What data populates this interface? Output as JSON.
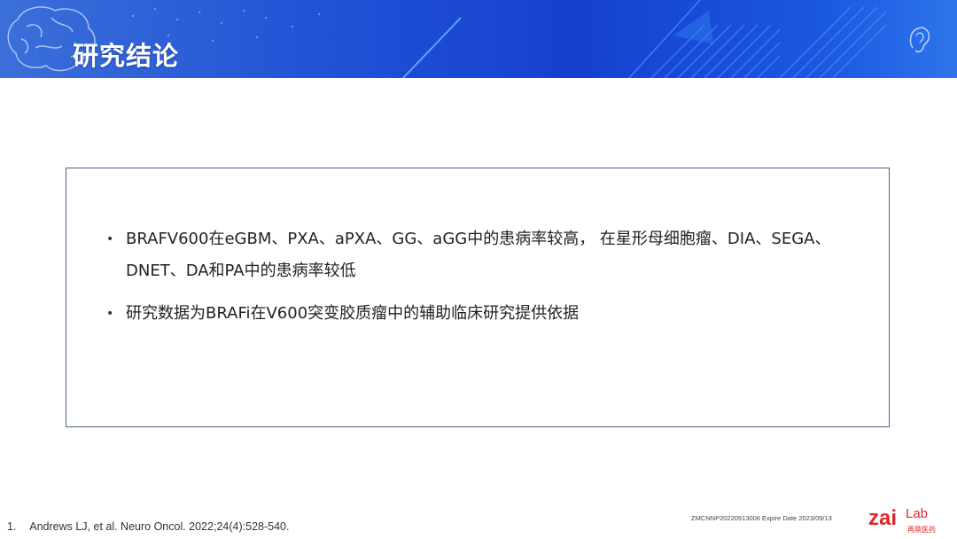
{
  "header": {
    "title": "研究结论"
  },
  "content": {
    "bullets": [
      "BRAFV600在eGBM、PXA、aPXA、GG、aGG中的患病率较高， 在星形母细胞瘤、DIA、SEGA、DNET、DA和PA中的患病率较低",
      "研究数据为BRAFi在V600突变胶质瘤中的辅助临床研究提供依据"
    ],
    "bullet_glyph": "•"
  },
  "footer": {
    "reference_number": "1.",
    "reference_text": "Andrews LJ, et al. Neuro Oncol. 2022;24(4):528-540.",
    "expire_text": "ZMCNNP20220913006 Expire Date 2023/09/13",
    "logo_text": "zaiLab",
    "logo_subtext": "再鼎医药"
  },
  "colors": {
    "banner": "#1a4bd4",
    "accent_logo": "#e0262b",
    "box_border": "#4a5f8a"
  },
  "icons": [
    "brain-icon",
    "ear-icon"
  ]
}
